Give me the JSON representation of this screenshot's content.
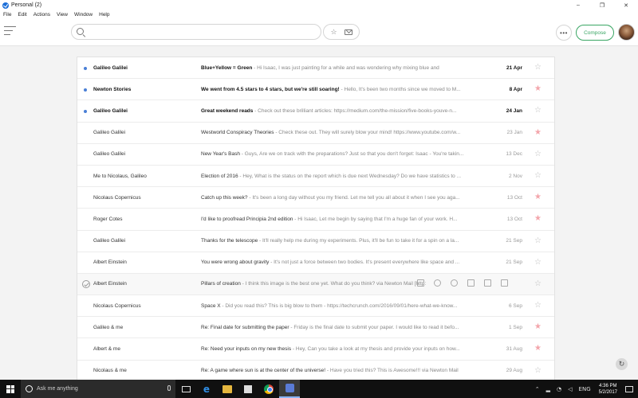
{
  "window": {
    "title": "Personal (2)",
    "controls": {
      "minimize": "–",
      "restore": "❐",
      "close": "✕"
    }
  },
  "menu": [
    "File",
    "Edit",
    "Actions",
    "View",
    "Window",
    "Help"
  ],
  "toolbar": {
    "search_placeholder": "",
    "compose_label": "Compose",
    "more_label": "•••",
    "star_glyph": "☆"
  },
  "emails": [
    {
      "sender": "Galileo Galilei",
      "subject": "Blue+Yellow = Green",
      "preview": " - Hi Isaac, I was just painting for a while and was wondering why mixing blue and",
      "date": "21 Apr",
      "unread": true,
      "starred": false
    },
    {
      "sender": "Newton Stories",
      "subject": "We went from 4.5 stars to 4 stars, but we're still soaring!",
      "preview": " - Hello, It's been two months since we moved to M...",
      "date": "8 Apr",
      "unread": true,
      "starred": true
    },
    {
      "sender": "Galileo Galilei",
      "subject": "Great weekend reads",
      "preview": " - Check out these brilliant articles: https://medium.com/the-mission/five-books-youve-n...",
      "date": "24 Jan",
      "unread": true,
      "starred": false
    },
    {
      "sender": "Galileo Galilei",
      "subject": "Westworld Conspiracy Theories",
      "preview": " - Check these out. They will surely blow your mind! https://www.youtube.com/w...",
      "date": "23 Jan",
      "unread": false,
      "starred": true
    },
    {
      "sender": "Galileo Galilei",
      "subject": "New Year's Bash",
      "preview": " - Guys, Are we on track with the preparations? Just so that you don't forget: Isaac - You're takin...",
      "date": "13 Dec",
      "unread": false,
      "starred": false
    },
    {
      "sender": "Me to Nicolaus, Galileo",
      "subject": "Election of 2016",
      "preview": " - Hey, What is the status on the report which is due next Wednesday? Do we have statistics to ...",
      "date": "2 Nov",
      "unread": false,
      "starred": false
    },
    {
      "sender": "Nicolaus Copernicus",
      "subject": "Catch up this week?",
      "preview": " - It's been a long day without you my friend. Let me tell you all about it when I see you aga...",
      "date": "13 Oct",
      "unread": false,
      "starred": true
    },
    {
      "sender": "Roger Cotes",
      "subject": "I'd like to proofread Principia 2nd edition",
      "preview": " - Hi Isaac, Let me begin by saying that I'm a huge fan of your work. H...",
      "date": "13 Oct",
      "unread": false,
      "starred": true
    },
    {
      "sender": "Galileo Galilei",
      "subject": "Thanks for the telescope",
      "preview": " - It'll really help me during my experiments. Plus, it'll be fun to take it for a spin on a la...",
      "date": "21 Sep",
      "unread": false,
      "starred": false
    },
    {
      "sender": "Albert Einstein",
      "subject": "You were wrong about gravity",
      "preview": " - It's not just a force between two bodies. It's present everywhere like space and ...",
      "date": "21 Sep",
      "unread": false,
      "starred": false
    },
    {
      "sender": "Albert Einstein",
      "subject": "Pillars of creation",
      "preview": " - I think this image is the best one yet. What do you think? via Newton Mail [http:",
      "date": "",
      "unread": false,
      "starred": false,
      "hover": true
    },
    {
      "sender": "Nicolaus Copernicus",
      "subject": "Space X",
      "preview": " - Did you read this? This is big blow to them - https://techcrunch.com/2016/09/01/here-what-we-know...",
      "date": "6 Sep",
      "unread": false,
      "starred": false
    },
    {
      "sender": "Galileo & me",
      "subject": "Re: Final date for submitting the paper",
      "preview": " - Friday is the final date to submit your paper. I would like to read it befo...",
      "date": "1 Sep",
      "unread": false,
      "starred": true
    },
    {
      "sender": "Albert & me",
      "subject": "Re: Need your inputs on my new thesis",
      "preview": " - Hey, Can you take a look at my thesis and provide your inputs on how...",
      "date": "31 Aug",
      "unread": false,
      "starred": true
    },
    {
      "sender": "Nicolaus & me",
      "subject": "Re: A game where sun is at the center of the universe!",
      "preview": " - Have you tried this? This is Awesome!!! via Newton Mail",
      "date": "29 Aug",
      "unread": false,
      "starred": false
    }
  ],
  "taskbar": {
    "search_text": "Ask me anything",
    "language": "ENG",
    "time": "4:36 PM",
    "date": "5/2/2017"
  },
  "colors": {
    "accent_green": "#3aa664",
    "unread_dot": "#4a7fd6",
    "star_on": "#f3a5ab",
    "taskbar": "#101010"
  }
}
